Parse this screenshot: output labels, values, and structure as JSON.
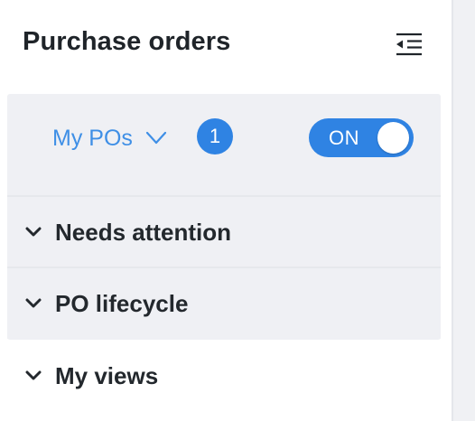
{
  "header": {
    "title": "Purchase orders",
    "collapse_icon": "collapse-menu-icon"
  },
  "filter": {
    "scope_label": "My POs",
    "scope_icon": "chevron-down-icon",
    "count": "1",
    "toggle_label": "ON",
    "toggle_state": true
  },
  "sections": [
    {
      "label": "Needs attention",
      "icon": "chevron-down-icon"
    },
    {
      "label": "PO lifecycle",
      "icon": "chevron-down-icon"
    },
    {
      "label": "My views",
      "icon": "chevron-down-icon"
    }
  ],
  "colors": {
    "accent": "#2f83e3",
    "link": "#3f8fe6",
    "panel_bg": "#eff0f4",
    "text": "#1f2429"
  }
}
